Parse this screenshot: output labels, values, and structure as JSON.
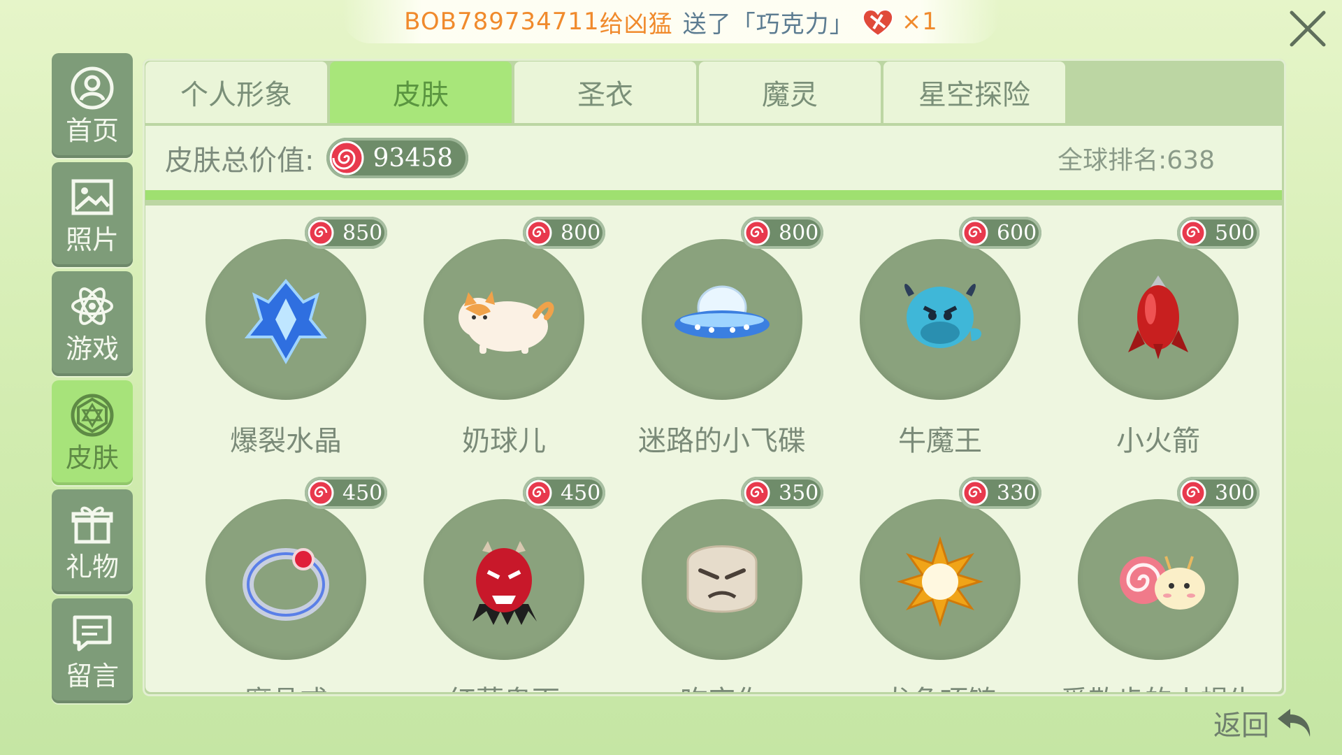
{
  "banner": {
    "sender": "BOB789734711",
    "gave": "给凶猛",
    "verb": "送了",
    "gift": "「巧克力」",
    "count": "×1"
  },
  "sidebar": {
    "items": [
      {
        "label": "首页",
        "icon": "person-icon"
      },
      {
        "label": "照片",
        "icon": "photo-icon"
      },
      {
        "label": "游戏",
        "icon": "atom-icon"
      },
      {
        "label": "皮肤",
        "icon": "gem-icon",
        "active": true
      },
      {
        "label": "礼物",
        "icon": "gift-icon"
      },
      {
        "label": "留言",
        "icon": "message-icon"
      }
    ]
  },
  "tabs": [
    {
      "label": "个人形象"
    },
    {
      "label": "皮肤",
      "active": true
    },
    {
      "label": "圣衣"
    },
    {
      "label": "魔灵"
    },
    {
      "label": "星空探险"
    }
  ],
  "summary": {
    "total_label": "皮肤总价值:",
    "total_value": "93458",
    "rank_label": "全球排名:",
    "rank_value": "638"
  },
  "skins": [
    {
      "name": "爆裂水晶",
      "price": "850",
      "icon": "crystal-icon"
    },
    {
      "name": "奶球儿",
      "price": "800",
      "icon": "cat-icon"
    },
    {
      "name": "迷路的小飞碟",
      "price": "800",
      "icon": "ufo-icon"
    },
    {
      "name": "牛魔王",
      "price": "600",
      "icon": "bull-demon-icon"
    },
    {
      "name": "小火箭",
      "price": "500",
      "icon": "rocket-icon"
    },
    {
      "name": "魔晶戒",
      "price": "450",
      "icon": "ring-icon"
    },
    {
      "name": "红莲鬼面",
      "price": "450",
      "icon": "demon-mask-icon"
    },
    {
      "name": "吃定你",
      "price": "350",
      "icon": "grumpy-face-icon"
    },
    {
      "name": "龙角项链",
      "price": "330",
      "icon": "sun-necklace-icon"
    },
    {
      "name": "爱散步的小蜗牛",
      "price": "300",
      "icon": "snail-icon"
    }
  ],
  "back": {
    "label": "返回"
  },
  "colors": {
    "accent_green": "#a8e67a",
    "nav_gray_green": "#7e9c79",
    "banner_orange": "#f08a2c"
  }
}
